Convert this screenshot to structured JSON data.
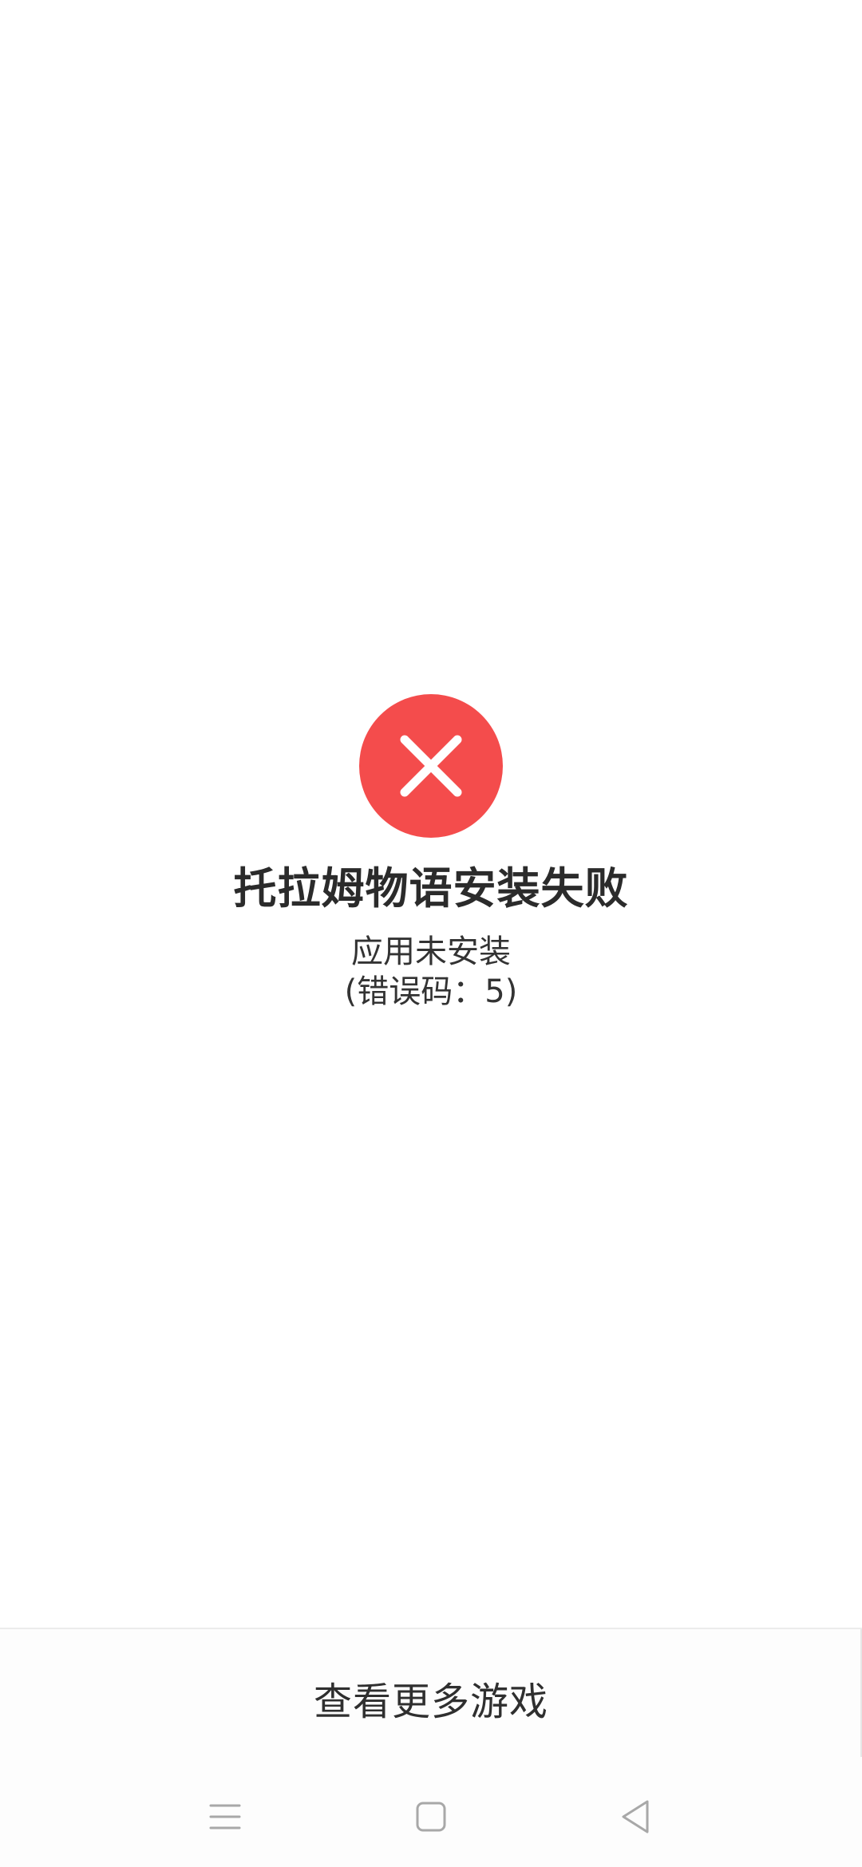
{
  "status": {
    "icon": "close-icon",
    "icon_color": "#f44c4c",
    "title": "托拉姆物语安装失败",
    "message": "应用未安装",
    "error_code": "(错误码：5)"
  },
  "actions": {
    "more_games_label": "查看更多游戏"
  },
  "nav_bar": {
    "menu_icon": "menu-icon",
    "home_icon": "home-square-icon",
    "back_icon": "back-triangle-icon"
  }
}
